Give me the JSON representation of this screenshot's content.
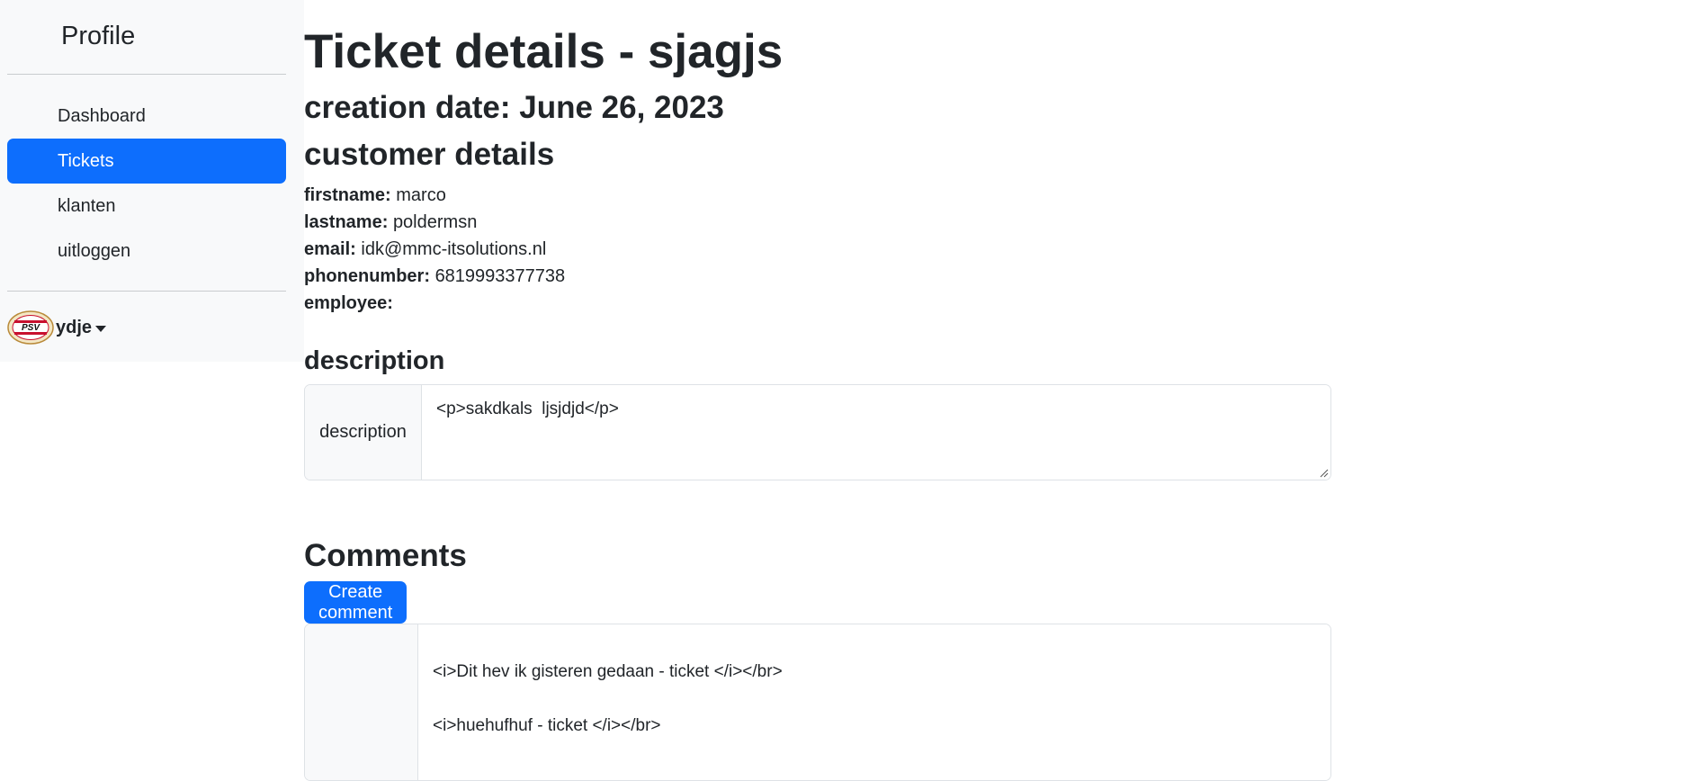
{
  "sidebar": {
    "brand": "Profile",
    "items": [
      {
        "label": "Dashboard",
        "active": false
      },
      {
        "label": "Tickets",
        "active": true
      },
      {
        "label": "klanten",
        "active": false
      },
      {
        "label": "uitloggen",
        "active": false
      }
    ],
    "user": {
      "name": "ydje",
      "avatar_text": "PSV"
    }
  },
  "main": {
    "title": "Ticket details - sjagjs",
    "creation_date": "creation date: June 26, 2023",
    "customer_heading": "customer details",
    "customer": {
      "firstname_label": "firstname:",
      "firstname": "marco",
      "lastname_label": "lastname:",
      "lastname": "poldermsn",
      "email_label": "email:",
      "email": "idk@mmc-itsolutions.nl",
      "phone_label": "phonenumber:",
      "phone": "6819993377738",
      "employee_label": "employee:",
      "employee": ""
    },
    "description_heading": "description",
    "description_label": "description",
    "description_value": "<p>sakdkals  ljsjdjd</p>",
    "comments_heading": "Comments",
    "create_comment_label": "Create comment",
    "comments": [
      "<i>Dit hev ik gisteren gedaan - ticket </i></br>",
      "<i>huehufhuf - ticket </i></br>"
    ]
  },
  "colors": {
    "primary": "#0d6efd",
    "sidebar_bg": "#f8f9fa",
    "text": "#212529",
    "border": "#dee2e6"
  }
}
